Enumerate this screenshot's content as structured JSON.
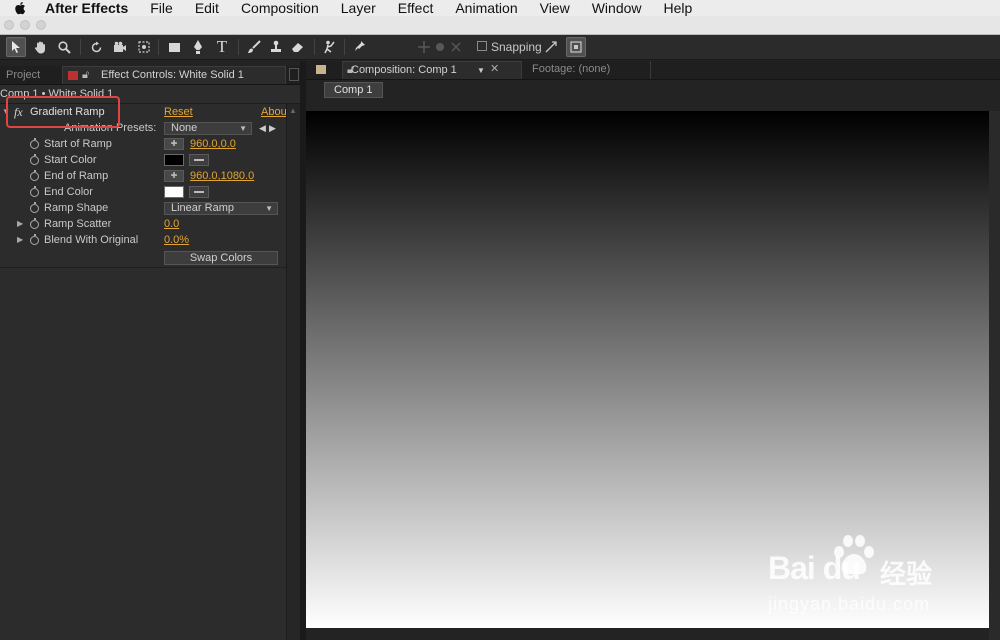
{
  "menubar": {
    "app_name": "After Effects",
    "items": [
      "File",
      "Edit",
      "Composition",
      "Layer",
      "Effect",
      "Animation",
      "View",
      "Window",
      "Help"
    ]
  },
  "toolbar": {
    "snapping_label": "Snapping"
  },
  "left_panel": {
    "project_tab": "Project",
    "effect_controls_tab": "Effect Controls: White Solid 1",
    "breadcrumb": "Comp 1 • White Solid 1",
    "effect": {
      "name": "Gradient Ramp",
      "fx_label": "fx",
      "reset_label": "Reset",
      "about_label": "Abou",
      "animation_presets_label": "Animation Presets:",
      "animation_presets_value": "None"
    },
    "properties": {
      "start_of_ramp": {
        "label": "Start of Ramp",
        "value": "960.0,0.0"
      },
      "start_color": {
        "label": "Start Color",
        "color": "#000000"
      },
      "end_of_ramp": {
        "label": "End of Ramp",
        "value": "960.0,1080.0"
      },
      "end_color": {
        "label": "End Color",
        "color": "#ffffff"
      },
      "ramp_shape": {
        "label": "Ramp Shape",
        "value": "Linear Ramp"
      },
      "ramp_scatter": {
        "label": "Ramp Scatter",
        "value": "0.0"
      },
      "blend_with_original": {
        "label": "Blend With Original",
        "value": "0.0%"
      }
    },
    "swap_colors_label": "Swap Colors"
  },
  "comp_panel": {
    "tab_label": "Composition: Comp 1",
    "footage_tab_label": "Footage: (none)",
    "subtab_label": "Comp 1",
    "viewer_gradient": {
      "start": "#000000",
      "end": "#ffffff"
    }
  },
  "watermark": {
    "brand": "Bai du",
    "brand_cn": "经验",
    "url": "jingyan.baidu.com"
  },
  "colors": {
    "accent_value": "#e2a533",
    "highlight_box": "#e04545"
  }
}
